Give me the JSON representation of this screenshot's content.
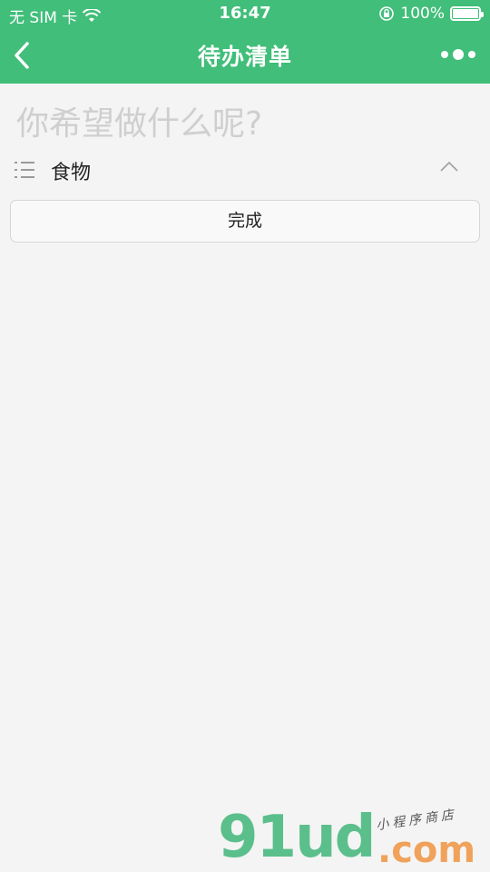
{
  "status_bar": {
    "carrier": "无 SIM 卡",
    "time": "16:47",
    "battery": "100%"
  },
  "nav": {
    "title": "待办清单"
  },
  "input": {
    "placeholder": "你希望做什么呢?"
  },
  "category": {
    "label": "食物"
  },
  "done_button": {
    "label": "完成"
  },
  "watermark": {
    "main": "91ud",
    "com": ".com",
    "tag": "小程序商店"
  },
  "colors": {
    "header": "#41be79",
    "background": "#f4f4f4"
  }
}
